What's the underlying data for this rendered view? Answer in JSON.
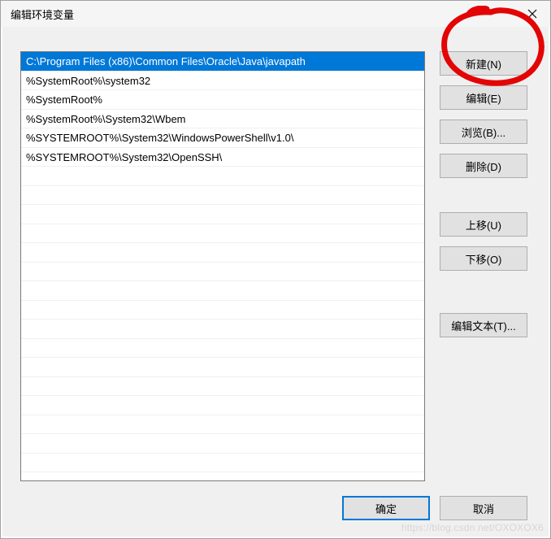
{
  "titlebar": {
    "title": "编辑环境变量"
  },
  "list": {
    "items": [
      "C:\\Program Files (x86)\\Common Files\\Oracle\\Java\\javapath",
      "%SystemRoot%\\system32",
      "%SystemRoot%",
      "%SystemRoot%\\System32\\Wbem",
      "%SYSTEMROOT%\\System32\\WindowsPowerShell\\v1.0\\",
      "%SYSTEMROOT%\\System32\\OpenSSH\\"
    ],
    "selected_index": 0
  },
  "buttons": {
    "new": "新建(N)",
    "edit": "编辑(E)",
    "browse": "浏览(B)...",
    "delete": "删除(D)",
    "move_up": "上移(U)",
    "move_down": "下移(O)",
    "edit_text": "编辑文本(T)...",
    "ok": "确定",
    "cancel": "取消"
  },
  "watermark": "https://blog.csdn.net/OXOXOX6",
  "annotation": {
    "target": "new-button",
    "color": "#e30505"
  }
}
